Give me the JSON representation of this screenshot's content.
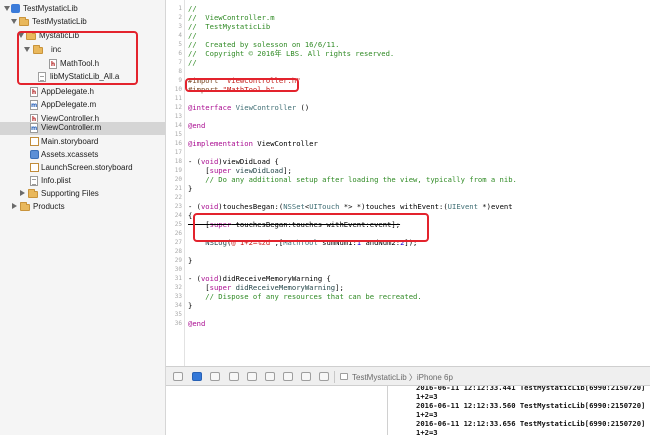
{
  "navigator": {
    "items": [
      {
        "label": "TestMystaticLib",
        "kind": "project",
        "disclosure": "open"
      },
      {
        "label": "TestMystaticLib",
        "kind": "folder",
        "disclosure": "open"
      },
      {
        "label": "MystaticLib",
        "kind": "folder",
        "disclosure": "open"
      },
      {
        "label": "inc",
        "kind": "folder",
        "disclosure": "open"
      },
      {
        "label": "MathTool.h",
        "kind": "header"
      },
      {
        "label": "libMyStaticLib_All.a",
        "kind": "library"
      },
      {
        "label": "AppDelegate.h",
        "kind": "header"
      },
      {
        "label": "AppDelegate.m",
        "kind": "implementation"
      },
      {
        "label": "ViewController.h",
        "kind": "header"
      },
      {
        "label": "ViewController.m",
        "kind": "implementation",
        "selected": true
      },
      {
        "label": "Main.storyboard",
        "kind": "storyboard"
      },
      {
        "label": "Assets.xcassets",
        "kind": "assets"
      },
      {
        "label": "LaunchScreen.storyboard",
        "kind": "storyboard"
      },
      {
        "label": "Info.plist",
        "kind": "plist"
      },
      {
        "label": "Supporting Files",
        "kind": "folder",
        "disclosure": "closed"
      },
      {
        "label": "Products",
        "kind": "folder",
        "disclosure": "closed"
      }
    ]
  },
  "editor": {
    "lines": [
      {
        "n": "1",
        "tokens": [
          {
            "t": "//",
            "c": "comment"
          }
        ]
      },
      {
        "n": "2",
        "tokens": [
          {
            "t": "//  ViewController.m",
            "c": "comment"
          }
        ]
      },
      {
        "n": "3",
        "tokens": [
          {
            "t": "//  TestMystaticLib",
            "c": "comment"
          }
        ]
      },
      {
        "n": "4",
        "tokens": [
          {
            "t": "//",
            "c": "comment"
          }
        ]
      },
      {
        "n": "5",
        "tokens": [
          {
            "t": "//  Created by solesson on 16/6/11.",
            "c": "comment"
          }
        ]
      },
      {
        "n": "6",
        "tokens": [
          {
            "t": "//  Copyright © 2016年 LBS. All rights reserved.",
            "c": "comment"
          }
        ]
      },
      {
        "n": "7",
        "tokens": [
          {
            "t": "//",
            "c": "comment"
          }
        ]
      },
      {
        "n": "8",
        "tokens": []
      },
      {
        "n": "9",
        "tokens": [
          {
            "t": "#import ",
            "c": "preproc"
          },
          {
            "t": "\"ViewController.h\"",
            "c": "string"
          }
        ]
      },
      {
        "n": "10",
        "tokens": [
          {
            "t": "#import ",
            "c": "preproc"
          },
          {
            "t": "\"MathTool.h\"",
            "c": "string"
          }
        ]
      },
      {
        "n": "11",
        "tokens": []
      },
      {
        "n": "12",
        "tokens": [
          {
            "t": "@interface ",
            "c": "keyword"
          },
          {
            "t": "ViewController",
            "c": "class"
          },
          {
            "t": " ()",
            "c": "plain"
          }
        ]
      },
      {
        "n": "13",
        "tokens": []
      },
      {
        "n": "14",
        "tokens": [
          {
            "t": "@end",
            "c": "keyword"
          }
        ]
      },
      {
        "n": "15",
        "tokens": []
      },
      {
        "n": "16",
        "tokens": [
          {
            "t": "@implementation ",
            "c": "keyword"
          },
          {
            "t": "ViewController",
            "c": "plain"
          }
        ]
      },
      {
        "n": "17",
        "tokens": []
      },
      {
        "n": "18",
        "tokens": [
          {
            "t": "- (",
            "c": "plain"
          },
          {
            "t": "void",
            "c": "keyword"
          },
          {
            "t": ")viewDidLoad {",
            "c": "plain"
          }
        ]
      },
      {
        "n": "19",
        "tokens": [
          {
            "t": "    [",
            "c": "plain"
          },
          {
            "t": "super",
            "c": "keyword"
          },
          {
            "t": " ",
            "c": "plain"
          },
          {
            "t": "viewDidLoad",
            "c": "method"
          },
          {
            "t": "];",
            "c": "plain"
          }
        ]
      },
      {
        "n": "20",
        "tokens": [
          {
            "t": "    // Do any additional setup after loading the view, typically from a nib.",
            "c": "comment"
          }
        ]
      },
      {
        "n": "21",
        "tokens": [
          {
            "t": "}",
            "c": "plain"
          }
        ]
      },
      {
        "n": "22",
        "tokens": []
      },
      {
        "n": "23",
        "tokens": [
          {
            "t": "- (",
            "c": "plain"
          },
          {
            "t": "void",
            "c": "keyword"
          },
          {
            "t": ")touchesBegan:(",
            "c": "plain"
          },
          {
            "t": "NSSet",
            "c": "class"
          },
          {
            "t": "<",
            "c": "plain"
          },
          {
            "t": "UITouch",
            "c": "class"
          },
          {
            "t": " *> *)touches withEvent:(",
            "c": "plain"
          },
          {
            "t": "UIEvent",
            "c": "class"
          },
          {
            "t": " *)event",
            "c": "plain"
          }
        ]
      },
      {
        "n": "24",
        "tokens": [
          {
            "t": "{",
            "c": "plain"
          }
        ]
      },
      {
        "n": "25",
        "tokens": [
          {
            "t": "    [",
            "c": "plain"
          },
          {
            "t": "super",
            "c": "keyword"
          },
          {
            "t": " touchesBegan:touches withEvent:event];",
            "c": "plain"
          }
        ],
        "strike": true
      },
      {
        "n": "26",
        "tokens": []
      },
      {
        "n": "27",
        "tokens": [
          {
            "t": "    NSLog",
            "c": "method"
          },
          {
            "t": "(",
            "c": "plain"
          },
          {
            "t": "@\"1+2=%zd\"",
            "c": "string"
          },
          {
            "t": ",[",
            "c": "plain"
          },
          {
            "t": "MathTool",
            "c": "class"
          },
          {
            "t": " sumNum1:",
            "c": "plain"
          },
          {
            "t": "1",
            "c": "num"
          },
          {
            "t": " andNum2:",
            "c": "plain"
          },
          {
            "t": "2",
            "c": "num"
          },
          {
            "t": "]);",
            "c": "plain"
          }
        ]
      },
      {
        "n": "28",
        "tokens": []
      },
      {
        "n": "29",
        "tokens": [
          {
            "t": "}",
            "c": "plain"
          }
        ]
      },
      {
        "n": "30",
        "tokens": []
      },
      {
        "n": "31",
        "tokens": [
          {
            "t": "- (",
            "c": "plain"
          },
          {
            "t": "void",
            "c": "keyword"
          },
          {
            "t": ")didReceiveMemoryWarning {",
            "c": "plain"
          }
        ]
      },
      {
        "n": "32",
        "tokens": [
          {
            "t": "    [",
            "c": "plain"
          },
          {
            "t": "super",
            "c": "keyword"
          },
          {
            "t": " ",
            "c": "plain"
          },
          {
            "t": "didReceiveMemoryWarning",
            "c": "method"
          },
          {
            "t": "];",
            "c": "plain"
          }
        ]
      },
      {
        "n": "33",
        "tokens": [
          {
            "t": "    // Dispose of any resources that can be recreated.",
            "c": "comment"
          }
        ]
      },
      {
        "n": "34",
        "tokens": [
          {
            "t": "}",
            "c": "plain"
          }
        ]
      },
      {
        "n": "35",
        "tokens": []
      },
      {
        "n": "36",
        "tokens": [
          {
            "t": "@end",
            "c": "keyword"
          }
        ]
      }
    ]
  },
  "debug_bar": {
    "target": "TestMystaticLib",
    "device": "iPhone 6p",
    "target_label": "TestMystaticLib 〉iPhone 6p"
  },
  "console": {
    "lines": [
      "2016-06-11 12:12:33.441 TestMystaticLib[6990:2150720]",
      "1+2=3",
      "2016-06-11 12:12:33.560 TestMystaticLib[6990:2150720]",
      "1+2=3",
      "2016-06-11 12:12:33.656 TestMystaticLib[6990:2150720]",
      "1+2=3"
    ]
  },
  "colors": {
    "highlight": "#e3232d",
    "selection": "#d5d5d5",
    "comment": "#2f8a24",
    "string": "#c41a16",
    "keyword": "#aa0d91"
  }
}
